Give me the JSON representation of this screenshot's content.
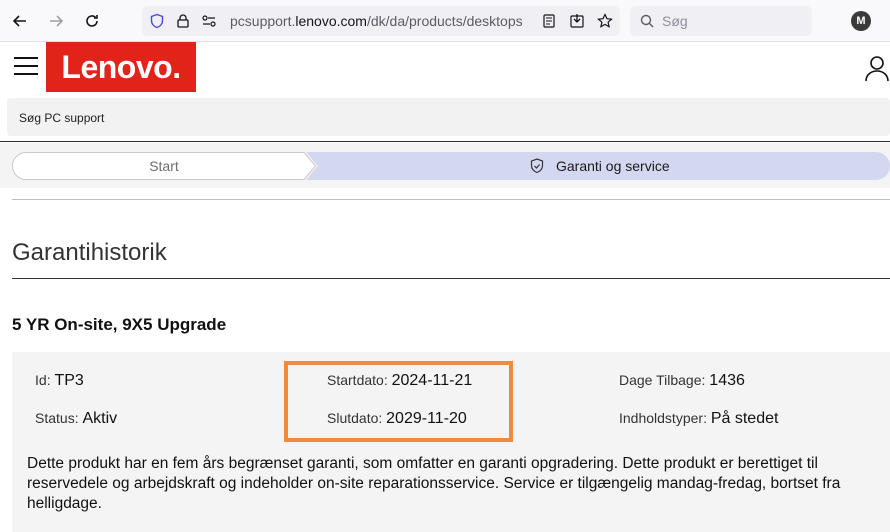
{
  "browser": {
    "url_prefix": "pcsupport.",
    "url_domain": "lenovo.com",
    "url_path": "/dk/da/products/desktops",
    "search_placeholder": "Søg",
    "profile_initial": "M"
  },
  "header": {
    "logo_text": "Lenovo.",
    "search_label": "Søg PC support"
  },
  "steps": {
    "start_label": "Start",
    "active_label": "Garanti og service"
  },
  "warranty": {
    "section_title": "Garantihistorik",
    "name": "5 YR On-site, 9X5 Upgrade",
    "id_label": "Id",
    "id_value": "TP3",
    "status_label": "Status",
    "status_value": "Aktiv",
    "start_label": "Startdato",
    "start_value": "2024-11-21",
    "end_label": "Slutdato",
    "end_value": "2029-11-20",
    "days_label": "Dage Tilbage",
    "days_value": "1436",
    "content_label": "Indholdstyper",
    "content_value": "På stedet",
    "description": "Dette produkt har en fem års begrænset garanti, som omfatter en garanti opgradering. Dette produkt er berettiget til reservedele og arbejdskraft og indeholder on-site reparationsservice. Service er tilgængelig mandag-fredag, bortset fra helligdage."
  },
  "colors": {
    "brand_red": "#e2231a",
    "step_active_bg": "#d3d8f0",
    "highlight_orange": "#f08a3c"
  }
}
